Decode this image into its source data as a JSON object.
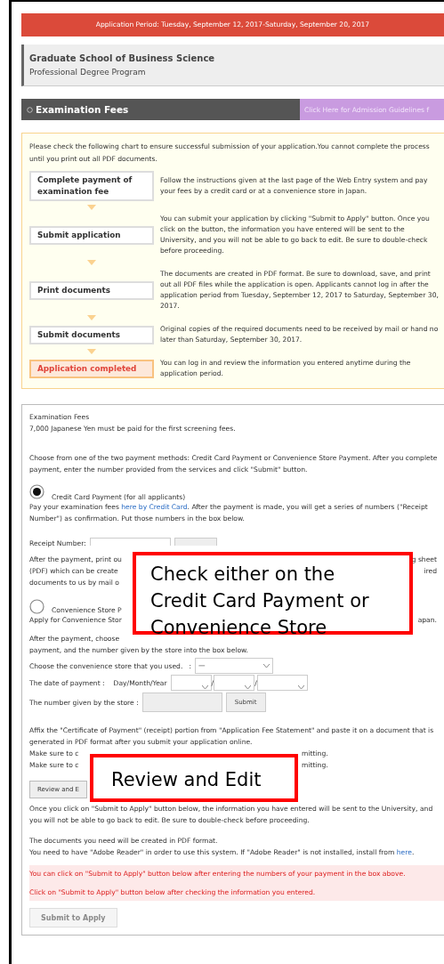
{
  "banner": "Application Period: Tuesday, September 12, 2017-Saturday, September 20, 2017",
  "school": {
    "name": "Graduate School of Business Science",
    "program": "Professional Degree Program"
  },
  "section": {
    "title": "Examination Fees",
    "guidelines_link": "Click Here for Admission Guidelines f"
  },
  "chart": {
    "intro": "Please check the following chart to ensure successful submission of your application.You cannot complete the process until you print out all PDF documents.",
    "steps": [
      {
        "label": "Complete payment of examination fee",
        "description": "Follow the instructions given at the last page of the Web Entry system and pay your fees by a credit card or at a convenience store in Japan.",
        "current": false
      },
      {
        "label": "Submit application",
        "description": "You can submit your application by clicking \"Submit to Apply\" button. Once you click on the button, the information you have entered will be sent to the University, and you will not be able to go back to edit. Be sure to double-check before proceeding.",
        "current": false
      },
      {
        "label": "Print documents",
        "description": "The documents are created in PDF format. Be sure to download, save, and print out all PDF files while the application is open. Applicants cannot log in after the application period from Tuesday, September 12, 2017 to Saturday, September 30, 2017.",
        "current": false
      },
      {
        "label": "Submit documents",
        "description": "Original copies of the required documents need to be received by mail or hand no later than Saturday, September 30, 2017.",
        "current": false
      },
      {
        "label": "Application completed",
        "description": "You can log in and review the information you entered anytime during the application period.",
        "current": true
      }
    ]
  },
  "form": {
    "title": "Examination Fees",
    "fee_note": "7,000 Japanese Yen must be paid for the first screening fees.",
    "choose_note": "Choose from one of the two payment methods: Credit Card Payment or Convenience Store Payment. After you complete payment, enter the number provided from the services and click \"Submit\" button.",
    "credit": {
      "selected": true,
      "label": "Credit Card Payment (for all applicants)",
      "text_before": "Pay your examination fees ",
      "link": "here by Credit Card",
      "text_after": ". After the payment is made, you will get a series of numbers (\"Receipt Number\") as confirmation. Put those numbers in the box below."
    },
    "receipt_label": "Receipt Number:",
    "covered_lines": [
      {
        "left": "After the payment, print ou",
        "right": "g sheet"
      },
      {
        "left": "(PDF) which can be create",
        "right": "ired"
      },
      {
        "left": "documents to us by mail o"
      }
    ],
    "convenience": {
      "selected": false,
      "label": "Convenience Store P",
      "apply_left": "Apply for Convenience Stor",
      "apply_right": "apan."
    },
    "payment_callout": "Check either on the Credit Card Payment or Convenience Store",
    "after_lines": [
      "After the payment, choose",
      "payment, and the number given by the store into the box below."
    ],
    "store_label": "Choose the convenience store that you used.   :",
    "store_value": "—",
    "date_label": "The date of payment :",
    "date_format": "Day/Month/Year",
    "date_separators": [
      "/",
      "/"
    ],
    "number_label": "The number given by the store :",
    "submit": "Submit",
    "affix": "Affix the \"Certificate of Payment\" (receipt) portion from \"Application Fee Statement\" and paste it on a document that is generated in PDF format after you submit your application online.",
    "make_sure_lines": [
      {
        "left": "Make sure to c",
        "right": "mitting."
      },
      {
        "left": "Make sure to c",
        "right": "mitting."
      }
    ],
    "review_button": "Review and E",
    "review_callout": "Review and Edit",
    "once": "Once you click on \"Submit to Apply\" button below, the information you have entered will be sent to the University, and you will not be able to go back to edit. Be sure to double-check before proceeding.",
    "pdf_note": "The documents you need will be created in PDF format.",
    "adobe_text": "You need to have \"Adobe Reader\" in order to use this system. If \"Adobe Reader\" is not installed, install from ",
    "adobe_link": "here",
    "adobe_end": ".",
    "warnings": [
      "You can click on \"Submit to Apply\" button below after entering the numbers of your payment in the box above.",
      "Click on \"Submit to Apply\" button below after checking the information you entered."
    ],
    "submit_apply": {
      "label": "Submit to Apply",
      "disabled": true
    }
  }
}
